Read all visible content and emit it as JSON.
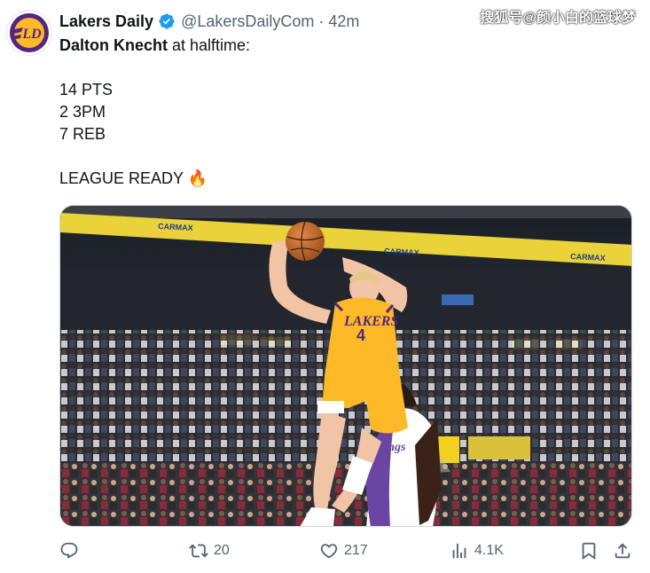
{
  "tweet": {
    "author_name": "Lakers Daily",
    "author_handle": "@LakersDailyCom",
    "separator": "·",
    "time": "42m",
    "text": {
      "player_name": "Dalton Knecht",
      "intro_rest": " at halftime:",
      "stat_lines": [
        "14 PTS",
        "2 3PM",
        "7 REB"
      ],
      "closing": "LEAGUE READY 🔥"
    }
  },
  "watermark": "搜狐号@颜小白的篮球梦",
  "media": {
    "jersey_team": "LAKERS",
    "jersey_number": "4",
    "opponent_jersey": "Kings",
    "banner_brand": "CARMAX"
  },
  "avatar_logo_text": "LAKERS DAILY",
  "actions": {
    "replies": "",
    "retweets": "20",
    "likes": "217",
    "views": "4.1K"
  },
  "colors": {
    "lakers_purple": "#552583",
    "lakers_gold": "#fdb927",
    "text_secondary": "#536471",
    "verified_blue": "#1d9bf0"
  }
}
